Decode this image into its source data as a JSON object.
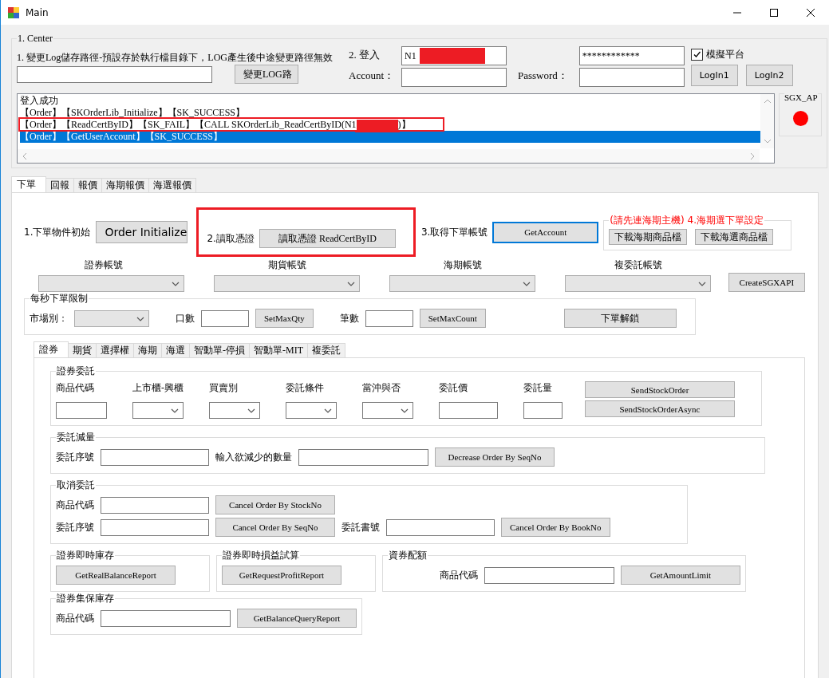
{
  "window": {
    "title": "Main"
  },
  "center": {
    "legend": "1. Center",
    "log_path_label": "1. 變更Log儲存路徑-預設存於執行檔目錄下，LOG產生後中途變更路徑無效",
    "change_log_button": "變更LOG路",
    "login_label": "2. 登入",
    "account_label": "Account：",
    "account_value": "N1",
    "password_label": "Password：",
    "password_value": "************",
    "simulate": {
      "label": "模擬平台",
      "checked": true
    },
    "login_buttons": [
      "LogIn1",
      "LogIn2"
    ]
  },
  "log": [
    {
      "text": "登入成功",
      "selected": false,
      "flagged": false
    },
    {
      "text": "【Order】【SKOrderLib_Initialize】【SK_SUCCESS】",
      "selected": false,
      "flagged": false
    },
    {
      "text": "【Order】【ReadCertByID】【SK_FAIL】【CALL SKOrderLib_ReadCertByID(N1",
      "tail": ")】",
      "selected": false,
      "flagged": true
    },
    {
      "text": "【Order】【GetUserAccount】【SK_SUCCESS】",
      "selected": true,
      "flagged": false
    }
  ],
  "sgx": {
    "label": "SGX_AP",
    "color": "#ff0000"
  },
  "main_tabs": [
    {
      "label": "下單",
      "selected": true
    },
    {
      "label": "回報",
      "selected": false
    },
    {
      "label": "報價",
      "selected": false
    },
    {
      "label": "海期報價",
      "selected": false
    },
    {
      "label": "海選報價",
      "selected": false
    }
  ],
  "order": {
    "step1_label": "1.下單物件初始",
    "step1_button": "Order Initialize",
    "step2_label": "2.讀取憑證",
    "step2_button": "讀取憑證  ReadCertByID",
    "step2_flagged": true,
    "step3_label": "3.取得下單帳號",
    "step3_button": "GetAccount",
    "step3_focused": true,
    "overseas": {
      "legend": "(請先連海期主機) 4.海期選下單設定",
      "buttons": [
        "下載海期商品檔",
        "下載海選商品檔"
      ]
    },
    "accounts": [
      "證券帳號",
      "期貨帳號",
      "海期帳號",
      "複委託帳號"
    ],
    "create_sgx_button": "CreateSGXAPI",
    "limit": {
      "legend": "每秒下單限制",
      "market_label": "市場別：",
      "qty_label": "口數",
      "qty_button": "SetMaxQty",
      "count_label": "筆數",
      "count_button": "SetMaxCount",
      "unlock_button": "下單解鎖"
    }
  },
  "sub_tabs": [
    {
      "label": "證券",
      "selected": true
    },
    {
      "label": "期貨",
      "selected": false
    },
    {
      "label": "選擇權",
      "selected": false
    },
    {
      "label": "海期",
      "selected": false
    },
    {
      "label": "海選",
      "selected": false
    },
    {
      "label": "智動單-停損",
      "selected": false
    },
    {
      "label": "智動單-MIT",
      "selected": false
    },
    {
      "label": "複委託",
      "selected": false
    }
  ],
  "stock_order": {
    "legend": "證券委託",
    "fields": [
      {
        "label": "商品代碼",
        "kind": "text"
      },
      {
        "label": "上市櫃-興櫃",
        "kind": "combo"
      },
      {
        "label": "買賣別",
        "kind": "combo"
      },
      {
        "label": "委託條件",
        "kind": "combo"
      },
      {
        "label": "當沖與否",
        "kind": "combo"
      },
      {
        "label": "委託價",
        "kind": "text"
      },
      {
        "label": "委託量",
        "kind": "text"
      }
    ],
    "buttons": [
      "SendStockOrder",
      "SendStockOrderAsync"
    ]
  },
  "groups": [
    {
      "legend": "委託減量",
      "rows": [
        [
          {
            "kind": "label",
            "text": "委託序號"
          },
          {
            "kind": "wide-field"
          },
          {
            "kind": "label",
            "text": "輸入欲減少的數量"
          },
          {
            "kind": "field"
          },
          {
            "kind": "wide-button",
            "text": "Decrease Order By SeqNo"
          }
        ]
      ]
    },
    {
      "legend": "取消委託",
      "rows": [
        [
          {
            "kind": "label",
            "text": "商品代碼"
          },
          {
            "kind": "wide-field"
          },
          {
            "kind": "wide-button",
            "text": "Cancel Order By StockNo"
          }
        ],
        [
          {
            "kind": "label",
            "text": "委託序號"
          },
          {
            "kind": "wide-field"
          },
          {
            "kind": "wide-button",
            "text": "Cancel Order By SeqNo"
          },
          {
            "kind": "label",
            "text": "委託書號"
          },
          {
            "kind": "wide-field"
          },
          {
            "kind": "button",
            "text": "Cancel Order By BookNo"
          }
        ]
      ]
    },
    {
      "legend": "證券即時庫存",
      "rows": [
        [
          {
            "kind": "wide-button",
            "text": "GetRealBalanceReport"
          }
        ]
      ]
    },
    {
      "legend": "證券即時損益試算",
      "rows": [
        [
          {
            "kind": "wide-button",
            "text": "GetRequestProfitReport"
          }
        ]
      ]
    },
    {
      "legend": "資券配額",
      "rows": [
        [
          {
            "kind": "label",
            "text": "商品代碼"
          },
          {
            "kind": "field"
          },
          {
            "kind": "wide-button",
            "text": "GetAmountLimit"
          }
        ]
      ]
    },
    {
      "legend": "證券集保庫存",
      "rows": [
        [
          {
            "kind": "label",
            "text": "商品代碼"
          },
          {
            "kind": "field"
          },
          {
            "kind": "wide-button",
            "text": "GetBalanceQueryReport"
          }
        ]
      ]
    }
  ]
}
